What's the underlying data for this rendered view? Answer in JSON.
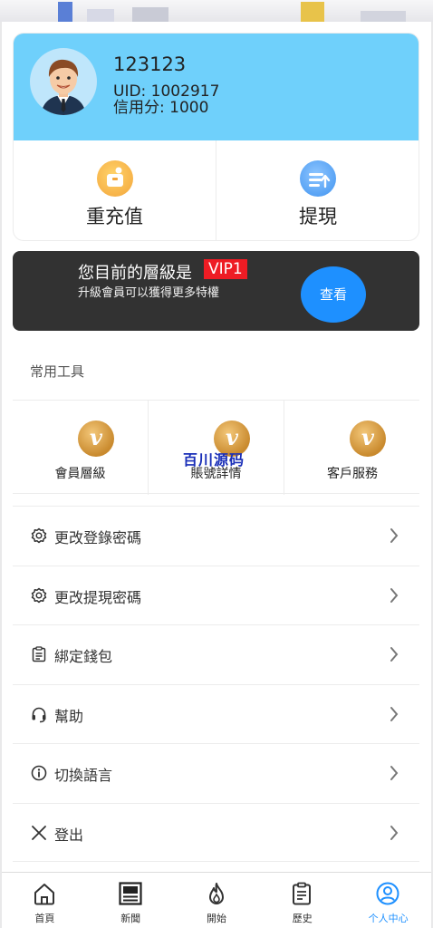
{
  "profile": {
    "username": "123123",
    "uid": "UID: 1002917",
    "credit": "信用分: 1000",
    "recharge_label": "重充值",
    "withdraw_label": "提現"
  },
  "vip": {
    "title": "您目前的層級是",
    "level": "VIP1",
    "subtitle": "升級會員可以獲得更多特權",
    "view_label": "查看"
  },
  "tools": {
    "title": "常用工具",
    "coin_glyph": "v",
    "items": [
      {
        "label": "會員層級"
      },
      {
        "label": "賬號詳情"
      },
      {
        "label": "客戶服務"
      }
    ]
  },
  "watermark": "百川源码",
  "menu": {
    "items": [
      {
        "label": "更改登錄密碼",
        "icon": "gear-icon"
      },
      {
        "label": "更改提現密碼",
        "icon": "gear-icon"
      },
      {
        "label": "綁定錢包",
        "icon": "clipboard-icon"
      },
      {
        "label": "幫助",
        "icon": "headset-icon"
      },
      {
        "label": "切換語言",
        "icon": "info-icon"
      },
      {
        "label": "登出",
        "icon": "close-icon"
      }
    ]
  },
  "tabbar": {
    "items": [
      {
        "label": "首頁",
        "icon": "home-icon"
      },
      {
        "label": "新聞",
        "icon": "news-icon"
      },
      {
        "label": "開始",
        "icon": "flame-icon"
      },
      {
        "label": "歷史",
        "icon": "clipboard-icon"
      },
      {
        "label": "个人中心",
        "icon": "user-icon",
        "active": true
      }
    ]
  },
  "colors": {
    "header_bg": "#6fd0fb",
    "vip_bg": "#323232",
    "vip_badge": "#ee1c24",
    "accent": "#1e90ff"
  }
}
